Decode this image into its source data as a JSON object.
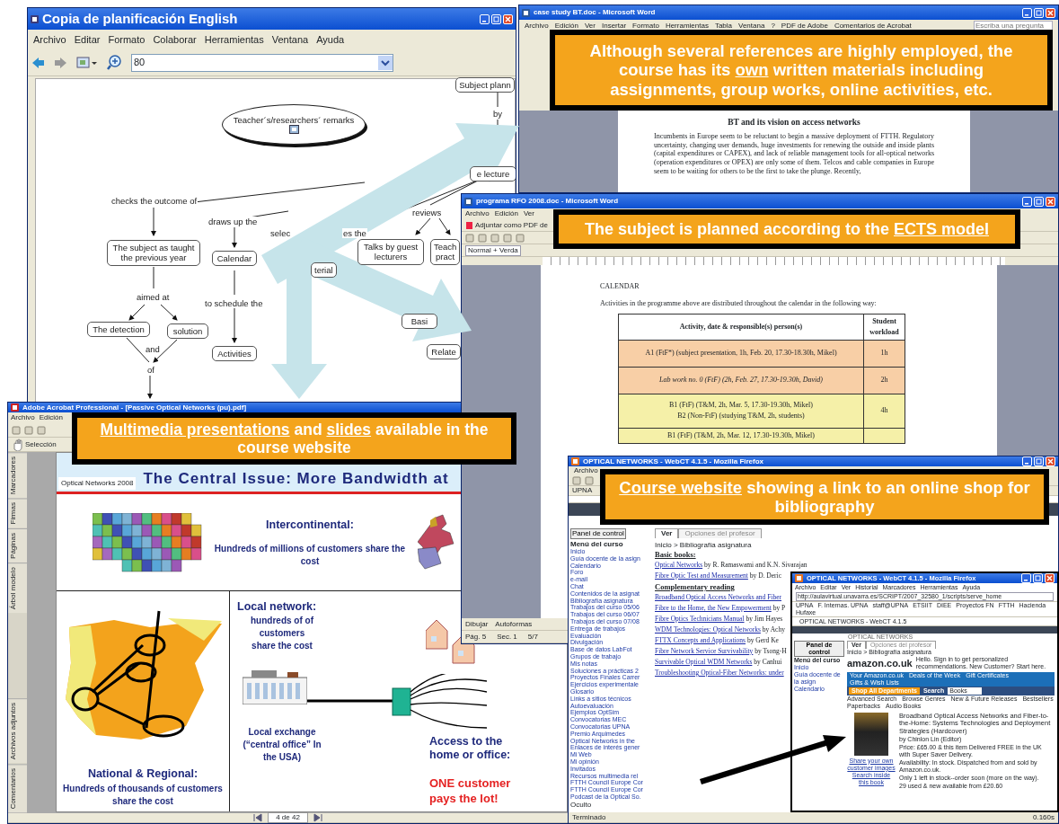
{
  "concept_map_window": {
    "title": "Copia de planificación English",
    "menu": [
      "Archivo",
      "Editar",
      "Formato",
      "Colaborar",
      "Herramientas",
      "Ventana",
      "Ayuda"
    ],
    "zoom": "80",
    "nodes": [
      {
        "kind": "ellipse",
        "text": "Teacher´s/researchers´ remarks"
      },
      {
        "kind": "box",
        "text": "Subject plann"
      },
      {
        "kind": "label",
        "text": "by"
      },
      {
        "kind": "box",
        "text": "e lecture"
      },
      {
        "kind": "label",
        "text": "checks the outcome of"
      },
      {
        "kind": "label",
        "text": "draws up the"
      },
      {
        "kind": "label",
        "text": "selec"
      },
      {
        "kind": "label",
        "text": "es the"
      },
      {
        "kind": "label",
        "text": "reviews"
      },
      {
        "kind": "box",
        "text": "The subject as taught\nthe previous year"
      },
      {
        "kind": "box",
        "text": "Calendar"
      },
      {
        "kind": "box",
        "text": "Talks by guest\nlecturers"
      },
      {
        "kind": "box",
        "text": "Teach\npract"
      },
      {
        "kind": "box",
        "text": "terial"
      },
      {
        "kind": "label",
        "text": "aimed at"
      },
      {
        "kind": "label",
        "text": "to schedule the"
      },
      {
        "kind": "box",
        "text": "The detection"
      },
      {
        "kind": "box",
        "text": "solution"
      },
      {
        "kind": "label",
        "text": "and"
      },
      {
        "kind": "label",
        "text": "of"
      },
      {
        "kind": "box",
        "text": "Activities"
      },
      {
        "kind": "box",
        "text": "Basi"
      },
      {
        "kind": "box",
        "text": "Relate"
      }
    ]
  },
  "case_study_window": {
    "title": "case study BT.doc - Microsoft Word",
    "menu": [
      "Archivo",
      "Edición",
      "Ver",
      "Insertar",
      "Formato",
      "Herramientas",
      "Tabla",
      "Ventana",
      "?",
      "PDF de Adobe",
      "Comentarios de Acrobat"
    ],
    "help_placeholder": "Escriba una pregunta",
    "heading": "BT and its vision on access networks",
    "paragraph": "Incumbents in Europe seem to be reluctant to begin a massive deployment of FTTH. Regulatory uncertainty, changing user demands, huge investments for renewing the outside and inside plants (capital expenditures or CAPEX), and lack of reliable management tools for all-optical networks (operation expenditures or OPEX) are only some of them. Telcos and cable companies in Europe seem to be waiting for others to be the first to take the plunge. Recently,"
  },
  "programme_window": {
    "title": "programa RFO 2008.doc - Microsoft Word",
    "menu": [
      "Archivo",
      "Edición",
      "Ver"
    ],
    "attach_button": "Adjuntar como PDF de",
    "style": "Normal + Verda",
    "section_title": "CALENDAR",
    "intro": "Activities in the programme above are distributed throughout the calendar in the following way:",
    "table": {
      "columns": [
        "Activity, date & responsible(s) person(s)",
        "Student workload"
      ],
      "rows": [
        {
          "lines": [
            "A1 (FtF*) (subject presentation, 1h, Feb. 20, 17.30-18.30h, Mikel)"
          ],
          "workload": "1h",
          "color": "#f8cfa6",
          "italic": false
        },
        {
          "lines": [
            "Lab work no. 0 (FtF) (2h, Feb. 27, 17.30-19.30h, David)"
          ],
          "workload": "2h",
          "color": "#f8cfa6",
          "italic": true
        },
        {
          "lines": [
            "B1 (FtF) (T&M, 2h, Mar. 5, 17.30-19.30h, Mikel)",
            "B2 (Non-FtF) (studying T&M, 2h, students)"
          ],
          "workload": "4h",
          "color": "#f5f0a8",
          "italic": false
        },
        {
          "lines": [
            "B1 (FtF) (T&M, 2h, Mar. 12, 17.30-19.30h, Mikel)"
          ],
          "color": "#f5f0a8",
          "italic": false
        }
      ]
    },
    "drawing_toolbar": [
      "Dibujar",
      "Autoformas"
    ],
    "status_bar": [
      "Pág. 5",
      "Sec. 1",
      "5/7"
    ]
  },
  "acrobat_window": {
    "title": "Adobe Acrobat Professional - [Passive Optical Networks (pu).pdf]",
    "menu": [
      "Archivo",
      "Edición"
    ],
    "select_tool": "Selección",
    "side_tabs": [
      "Marcadores",
      "Firmas",
      "Páginas",
      "Árbol modelo",
      "Archivos adjuntos",
      "Comentarios"
    ],
    "page": "4 de 42",
    "slide": {
      "course": "Optical Networks 2008",
      "title": "The Central Issue:  More Bandwidth at",
      "intercontinental": "Intercontinental:",
      "intercontinental_note": "Hundreds of millions of customers share the cost",
      "national": "National & Regional:",
      "national_note": "Hundreds of thousands of customers share the cost",
      "local": "Local network:",
      "local_note": "hundreds of of customers share the cost",
      "exchange": "Local exchange (“central office” In the USA)",
      "access": "Access to the home or office:",
      "one_customer": "ONE customer pays the lot!"
    }
  },
  "webct_window": {
    "title": "OPTICAL NETWORKS - WebCT 4.1.5 - Mozilla Firefox",
    "menu": [
      "Archivo"
    ],
    "bookmark": "UPNA",
    "control_panel": "Panel de control",
    "course_menu": "Menú del curso",
    "menu_items": [
      "Inicio",
      "Guía docente de la asign",
      "Calendario",
      "Foro",
      "e-mail",
      "Chat",
      "Contenidos de la asignat",
      "Bibliografía asignatura",
      "Trabajos del curso 05/06",
      "Trabajos del curso 06/07",
      "Trabajos del curso 07/08",
      "Entrega de trabajos",
      "Evaluación",
      "Divulgación",
      "Base de datos LabFot",
      "Grupos de trabajo",
      "Mis notas",
      "Soluciones a prácticas 2",
      "Proyectos Finales Carrer",
      "Ejercicios experimentale",
      "Glosario",
      "Links a sitios técnicos",
      "Autoevaluación",
      "Ejemplos OptSim",
      "Convocatorias MEC",
      "Convocatorias UPNA",
      "Premio Arquimedes",
      "Optical Networks in the",
      "Enlaces de interés gener",
      "Mi Web",
      "Mi opinión",
      "Invitados",
      "Recursos multimedia rel",
      "FTTH Council Europe Cor",
      "FTTH Council Europe Cor",
      "Podcast de la Optical So."
    ],
    "hidden_note": "Oculto",
    "tabs": [
      {
        "label": "Ver",
        "selected": true
      },
      {
        "label": "Opciones del profesor",
        "selected": false
      }
    ],
    "breadcrumb": "Inicio > Bibliografía asignatura",
    "sections": [
      {
        "heading": "Basic books:",
        "refs": [
          {
            "link": "Optical Networks",
            "rest": " by R. Ramaswami and K.N. Sivarajan"
          },
          {
            "link": "Fibre Optic Test and Measurement",
            "rest": " by D. Deric"
          }
        ]
      },
      {
        "heading": "Complementary reading",
        "refs": [
          {
            "link": "Broadband Optical Access Networks and Fiber"
          },
          {
            "link": "Fibre to the Home, the New Empowerment",
            "rest": " by P"
          },
          {
            "link": "Fibre Optics Technicians Manual",
            "rest": " by Jim Hayes"
          },
          {
            "link": "WDM Technologies: Optical Networks",
            "rest": " by Achy"
          },
          {
            "link": "FTTX Concepts and Applications",
            "rest": " by Gerd Ke"
          },
          {
            "link": "Fibre Network Service Survivability",
            "rest": " by Tsong-H"
          },
          {
            "link": "Survivable Optical WDM Networks",
            "rest": " by Canhui"
          },
          {
            "link": "Troubleshooting Optical-Fiber Networks: under"
          }
        ]
      }
    ],
    "status": "Terminado",
    "speed": "0.160s"
  },
  "inner_window": {
    "title": "OPTICAL NETWORKS - WebCT 4.1.5 - Mozilla Firefox",
    "menu": [
      "Archivo",
      "Editar",
      "Ver",
      "Historial",
      "Marcadores",
      "Herramientas",
      "Ayuda"
    ],
    "url": "http://aulavirtual.unavarra.es/SCRIPT/2007_32580_1/scripts/serve_home",
    "bookmarks": [
      "UPNA",
      "F. Internas. UPNA",
      "staff@UPNA",
      "ETSIIT",
      "DIEE",
      "Proyectos FN",
      "FTTH",
      "Hacienda",
      "Hufaxe"
    ],
    "tab": "OPTICAL NETWORKS - WebCT 4.1.5",
    "site": "OPTICAL NETWORKS",
    "control_panel": "Panel de control",
    "course_menu": "Menú del curso",
    "menu_items": [
      "Inicio",
      "Guía docente de la asign",
      "Calendario"
    ],
    "tabs": [
      {
        "label": "Ver",
        "selected": true
      },
      {
        "label": "Opciones del profesor",
        "selected": false
      }
    ],
    "breadcrumb": "Inicio > Bibliografía asignatura",
    "shop": {
      "logo": "amazon.co.uk",
      "greeting": "Hello. Sign in to get personalized recommendations. New Customer? Start here.",
      "nav": [
        "Your Amazon.co.uk",
        "Deals of the Week",
        "Gift Certificates",
        "Gifts & Wish Lists"
      ],
      "departments": "Shop All Departments",
      "search_label": "Search",
      "search_category": "Books",
      "subnav": [
        "Advanced Search",
        "Browse Genres",
        "New & Future Releases",
        "Bestsellers",
        "Paperbacks",
        "Audio Books"
      ],
      "product_title": "Broadband Optical Access Networks and Fiber-to-the-Home: Systems Technologies and Deployment Strategies (Hardcover)",
      "byline": "by Chinlon Lin (Editor)",
      "price": "Price: £65.00 & this item Delivered FREE in the UK with Super Saver Delivery.",
      "availability": "Availability: In stock. Dispatched from and sold by Amazon.co.uk.",
      "stock": "Only 1 left in stock--order soon (more on the way).",
      "used_new": "29 used & new available from £20.60",
      "cover_links": [
        "Share your own customer images",
        "Search inside this book"
      ]
    }
  },
  "callouts": [
    {
      "segments": [
        {
          "text": "Although several references are highly employed, the course has its ",
          "underline": false
        },
        {
          "text": "own",
          "underline": true
        },
        {
          "text": " written materials including assignments, group works, online activities, etc.",
          "underline": false
        }
      ]
    },
    {
      "segments": [
        {
          "text": "The subject is planned according to the ",
          "underline": false
        },
        {
          "text": "ECTS model",
          "underline": true
        }
      ]
    },
    {
      "segments": [
        {
          "text": "Multimedia presentations",
          "underline": true
        },
        {
          "text": " and ",
          "underline": false
        },
        {
          "text": "slides",
          "underline": true
        },
        {
          "text": " available in the course website",
          "underline": false
        }
      ]
    },
    {
      "segments": [
        {
          "text": "Course website",
          "underline": true
        },
        {
          "text": " showing a link to an online shop for bibliography",
          "underline": false
        }
      ]
    }
  ]
}
